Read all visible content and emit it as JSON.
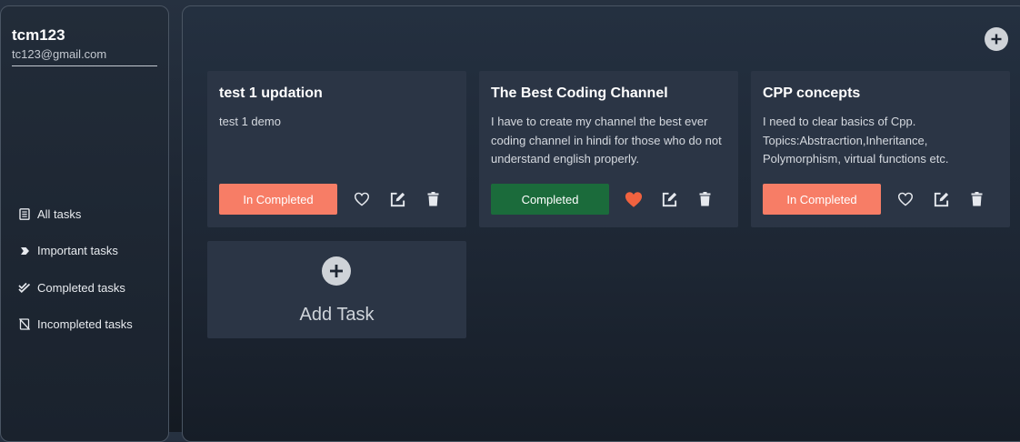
{
  "user": {
    "name": "tcm123",
    "email": "tc123@gmail.com"
  },
  "nav": {
    "items": [
      {
        "label": "All tasks",
        "icon": "notes-icon"
      },
      {
        "label": "Important tasks",
        "icon": "tag-icon"
      },
      {
        "label": "Completed tasks",
        "icon": "double-check-icon"
      },
      {
        "label": "Incompleted tasks",
        "icon": "notebook-slash-icon"
      }
    ]
  },
  "tasks": [
    {
      "title": "test 1 updation",
      "description": "test 1 demo",
      "status": "In Completed",
      "important": false
    },
    {
      "title": "The Best Coding Channel",
      "description": "I have to create my channel the best ever coding channel in hindi for those who do not understand english properly.",
      "status": "Completed",
      "important": true
    },
    {
      "title": "CPP concepts",
      "description": "I need to clear basics of Cpp. Topics:Abstracrtion,Inheritance, Polymorphism, virtual functions etc.",
      "status": "In Completed",
      "important": false
    }
  ],
  "add_task": {
    "label": "Add Task"
  },
  "colors": {
    "incomplete": "#f77d66",
    "complete": "#1b6b3b",
    "heart_active": "#f0623f",
    "card_bg": "#2b3545"
  }
}
